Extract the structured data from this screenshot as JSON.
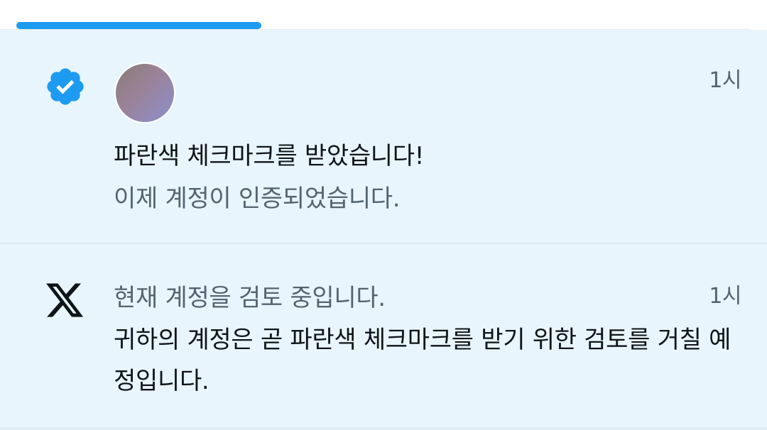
{
  "tab_bar": {
    "active_indicator_color": "#1d9bf0"
  },
  "notifications": [
    {
      "icon": "verified-badge-icon",
      "icon_color": "#1d9bf0",
      "time": "1시",
      "title": "파란색 체크마크를 받았습니다!",
      "subtitle": "이제 계정이 인증되었습니다.",
      "unread": true
    },
    {
      "icon": "x-logo-icon",
      "time": "1시",
      "title": "현재 계정을 검토 중입니다.",
      "body": "귀하의 계정은 곧 파란색 체크마크를 받기 위한 검토를 거칠 예정입니다.",
      "unread": true
    }
  ],
  "colors": {
    "unread_background": "#e8f5fd",
    "primary_text": "#0f1419",
    "secondary_text": "#536471",
    "accent": "#1d9bf0"
  }
}
